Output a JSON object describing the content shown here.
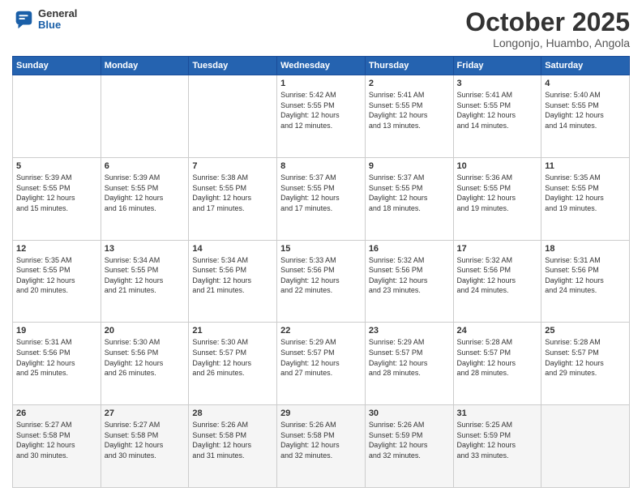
{
  "header": {
    "logo_general": "General",
    "logo_blue": "Blue",
    "title": "October 2025",
    "subtitle": "Longonjo, Huambo, Angola"
  },
  "days_of_week": [
    "Sunday",
    "Monday",
    "Tuesday",
    "Wednesday",
    "Thursday",
    "Friday",
    "Saturday"
  ],
  "weeks": [
    [
      {
        "day": "",
        "info": ""
      },
      {
        "day": "",
        "info": ""
      },
      {
        "day": "",
        "info": ""
      },
      {
        "day": "1",
        "info": "Sunrise: 5:42 AM\nSunset: 5:55 PM\nDaylight: 12 hours\nand 12 minutes."
      },
      {
        "day": "2",
        "info": "Sunrise: 5:41 AM\nSunset: 5:55 PM\nDaylight: 12 hours\nand 13 minutes."
      },
      {
        "day": "3",
        "info": "Sunrise: 5:41 AM\nSunset: 5:55 PM\nDaylight: 12 hours\nand 14 minutes."
      },
      {
        "day": "4",
        "info": "Sunrise: 5:40 AM\nSunset: 5:55 PM\nDaylight: 12 hours\nand 14 minutes."
      }
    ],
    [
      {
        "day": "5",
        "info": "Sunrise: 5:39 AM\nSunset: 5:55 PM\nDaylight: 12 hours\nand 15 minutes."
      },
      {
        "day": "6",
        "info": "Sunrise: 5:39 AM\nSunset: 5:55 PM\nDaylight: 12 hours\nand 16 minutes."
      },
      {
        "day": "7",
        "info": "Sunrise: 5:38 AM\nSunset: 5:55 PM\nDaylight: 12 hours\nand 17 minutes."
      },
      {
        "day": "8",
        "info": "Sunrise: 5:37 AM\nSunset: 5:55 PM\nDaylight: 12 hours\nand 17 minutes."
      },
      {
        "day": "9",
        "info": "Sunrise: 5:37 AM\nSunset: 5:55 PM\nDaylight: 12 hours\nand 18 minutes."
      },
      {
        "day": "10",
        "info": "Sunrise: 5:36 AM\nSunset: 5:55 PM\nDaylight: 12 hours\nand 19 minutes."
      },
      {
        "day": "11",
        "info": "Sunrise: 5:35 AM\nSunset: 5:55 PM\nDaylight: 12 hours\nand 19 minutes."
      }
    ],
    [
      {
        "day": "12",
        "info": "Sunrise: 5:35 AM\nSunset: 5:55 PM\nDaylight: 12 hours\nand 20 minutes."
      },
      {
        "day": "13",
        "info": "Sunrise: 5:34 AM\nSunset: 5:55 PM\nDaylight: 12 hours\nand 21 minutes."
      },
      {
        "day": "14",
        "info": "Sunrise: 5:34 AM\nSunset: 5:56 PM\nDaylight: 12 hours\nand 21 minutes."
      },
      {
        "day": "15",
        "info": "Sunrise: 5:33 AM\nSunset: 5:56 PM\nDaylight: 12 hours\nand 22 minutes."
      },
      {
        "day": "16",
        "info": "Sunrise: 5:32 AM\nSunset: 5:56 PM\nDaylight: 12 hours\nand 23 minutes."
      },
      {
        "day": "17",
        "info": "Sunrise: 5:32 AM\nSunset: 5:56 PM\nDaylight: 12 hours\nand 24 minutes."
      },
      {
        "day": "18",
        "info": "Sunrise: 5:31 AM\nSunset: 5:56 PM\nDaylight: 12 hours\nand 24 minutes."
      }
    ],
    [
      {
        "day": "19",
        "info": "Sunrise: 5:31 AM\nSunset: 5:56 PM\nDaylight: 12 hours\nand 25 minutes."
      },
      {
        "day": "20",
        "info": "Sunrise: 5:30 AM\nSunset: 5:56 PM\nDaylight: 12 hours\nand 26 minutes."
      },
      {
        "day": "21",
        "info": "Sunrise: 5:30 AM\nSunset: 5:57 PM\nDaylight: 12 hours\nand 26 minutes."
      },
      {
        "day": "22",
        "info": "Sunrise: 5:29 AM\nSunset: 5:57 PM\nDaylight: 12 hours\nand 27 minutes."
      },
      {
        "day": "23",
        "info": "Sunrise: 5:29 AM\nSunset: 5:57 PM\nDaylight: 12 hours\nand 28 minutes."
      },
      {
        "day": "24",
        "info": "Sunrise: 5:28 AM\nSunset: 5:57 PM\nDaylight: 12 hours\nand 28 minutes."
      },
      {
        "day": "25",
        "info": "Sunrise: 5:28 AM\nSunset: 5:57 PM\nDaylight: 12 hours\nand 29 minutes."
      }
    ],
    [
      {
        "day": "26",
        "info": "Sunrise: 5:27 AM\nSunset: 5:58 PM\nDaylight: 12 hours\nand 30 minutes."
      },
      {
        "day": "27",
        "info": "Sunrise: 5:27 AM\nSunset: 5:58 PM\nDaylight: 12 hours\nand 30 minutes."
      },
      {
        "day": "28",
        "info": "Sunrise: 5:26 AM\nSunset: 5:58 PM\nDaylight: 12 hours\nand 31 minutes."
      },
      {
        "day": "29",
        "info": "Sunrise: 5:26 AM\nSunset: 5:58 PM\nDaylight: 12 hours\nand 32 minutes."
      },
      {
        "day": "30",
        "info": "Sunrise: 5:26 AM\nSunset: 5:59 PM\nDaylight: 12 hours\nand 32 minutes."
      },
      {
        "day": "31",
        "info": "Sunrise: 5:25 AM\nSunset: 5:59 PM\nDaylight: 12 hours\nand 33 minutes."
      },
      {
        "day": "",
        "info": ""
      }
    ]
  ]
}
